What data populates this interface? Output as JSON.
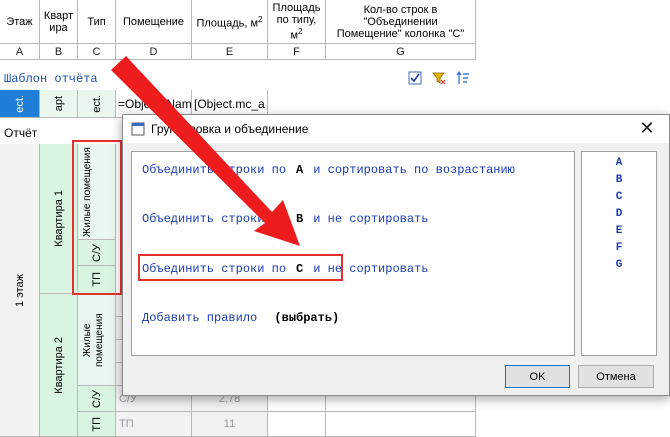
{
  "sheet": {
    "headers": {
      "floor": "Этаж",
      "apartment": "Квартира",
      "type": "Тип",
      "room": "Помещение",
      "area": "Площадь, м",
      "area_sup": "2",
      "area_by_type": "Площадь по типу, м",
      "area_by_type_sup": "2",
      "row_count": "Кол-во строк в \"Объединении Помещение\" колонка \"C\""
    },
    "column_letters": [
      "A",
      "B",
      "C",
      "D",
      "E",
      "F",
      "G"
    ],
    "template_label": "Шаблон отчёта",
    "template_cells": {
      "a": "ect.",
      "b": "apt",
      "c": "ect.",
      "room_formula": "=Object_Nam",
      "area_formula": "[Object.mc_a"
    },
    "report_label": "Отчёт",
    "floor_1": "1 этаж",
    "apartment_1": "Квартира 1",
    "apartment_2": "Квартира 2",
    "living_rooms": "Жилые помещения",
    "bathroom": "С/У",
    "tp": "ТП",
    "row_su_room": "С/У",
    "row_su_area": "2,78",
    "row_tp_room": "ТП",
    "row_tp_area": "11"
  },
  "dialog": {
    "title": "Группировка и объединение",
    "close_glyph": "✕",
    "rules": [
      {
        "prefix": "Объединить строки по",
        "column": "A",
        "suffix": "и сортировать по возрастанию"
      },
      {
        "prefix": "Объединить строки по",
        "column": "B",
        "suffix": "и не сортировать"
      },
      {
        "prefix": "Объединить строки по",
        "column": "C",
        "suffix": "и не сортировать"
      }
    ],
    "add_rule": {
      "label": "Добавить правило",
      "choose": "(выбрать)"
    },
    "columns": [
      "A",
      "B",
      "C",
      "D",
      "E",
      "F",
      "G"
    ],
    "ok_label": "OK",
    "cancel_label": "Отмена"
  },
  "toolbar_icons": [
    "checkbox-icon",
    "filter-icon",
    "sort-icon"
  ],
  "annotation_colors": {
    "highlight": "#e53030",
    "arrow": "#ee1c1c"
  }
}
